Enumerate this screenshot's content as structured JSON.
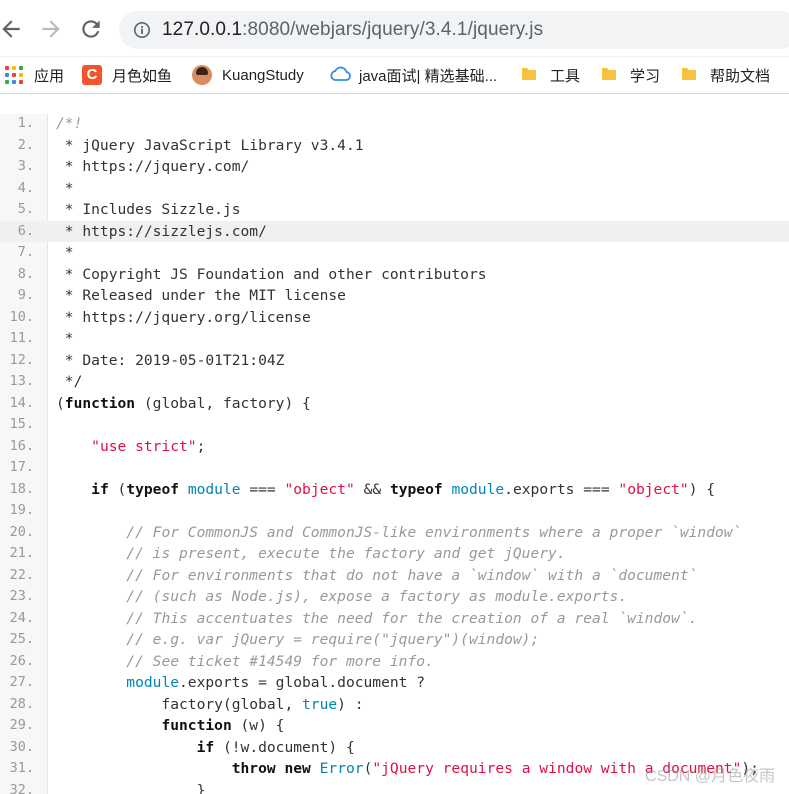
{
  "browser": {
    "url_host": "127.0.0.1",
    "url_rest": ":8080/webjars/jquery/3.4.1/jquery.js"
  },
  "bookmarks": [
    {
      "label": "应用",
      "icon": "apps-grid-icon"
    },
    {
      "label": "月色如鱼",
      "icon": "csdn-c-icon"
    },
    {
      "label": "KuangStudy",
      "icon": "avatar-icon"
    },
    {
      "label": "java面试| 精选基础...",
      "icon": "cloud-icon"
    },
    {
      "label": "工具",
      "icon": "folder-icon"
    },
    {
      "label": "学习",
      "icon": "folder-icon"
    },
    {
      "label": "帮助文档",
      "icon": "folder-icon"
    }
  ],
  "colors": {
    "keyword": "#111111",
    "string": "#dd1144",
    "comment": "#999999",
    "identifier": "#0086b3"
  },
  "code_lines": [
    {
      "n": "1.",
      "parts": [
        [
          "cm",
          "/*!"
        ]
      ]
    },
    {
      "n": "2.",
      "parts": [
        [
          "",
          " * jQuery JavaScript Library v3.4.1"
        ]
      ]
    },
    {
      "n": "3.",
      "parts": [
        [
          "",
          " * https://jquery.com/"
        ]
      ]
    },
    {
      "n": "4.",
      "parts": [
        [
          "",
          " *"
        ]
      ]
    },
    {
      "n": "5.",
      "parts": [
        [
          "",
          " * Includes Sizzle.js"
        ]
      ]
    },
    {
      "n": "6.",
      "parts": [
        [
          "",
          " * https://sizzlejs.com/"
        ]
      ]
    },
    {
      "n": "7.",
      "parts": [
        [
          "",
          " *"
        ]
      ]
    },
    {
      "n": "8.",
      "parts": [
        [
          "",
          " * Copyright JS Foundation and other contributors"
        ]
      ]
    },
    {
      "n": "9.",
      "parts": [
        [
          "",
          " * Released under the MIT license"
        ]
      ]
    },
    {
      "n": "10.",
      "parts": [
        [
          "",
          " * https://jquery.org/license"
        ]
      ]
    },
    {
      "n": "11.",
      "parts": [
        [
          "",
          " *"
        ]
      ]
    },
    {
      "n": "12.",
      "parts": [
        [
          "",
          " * Date: 2019-05-01T21:04Z"
        ]
      ]
    },
    {
      "n": "13.",
      "parts": [
        [
          "",
          " */"
        ]
      ]
    },
    {
      "n": "14.",
      "parts": [
        [
          "",
          "("
        ],
        [
          "kw",
          "function"
        ],
        [
          "",
          " (global, factory) {"
        ]
      ]
    },
    {
      "n": "15.",
      "parts": [
        [
          "",
          ""
        ]
      ]
    },
    {
      "n": "16.",
      "parts": [
        [
          "",
          "    "
        ],
        [
          "st",
          "\"use strict\""
        ],
        [
          "",
          ";"
        ]
      ]
    },
    {
      "n": "17.",
      "parts": [
        [
          "",
          ""
        ]
      ]
    },
    {
      "n": "18.",
      "parts": [
        [
          "",
          "    "
        ],
        [
          "kw",
          "if"
        ],
        [
          "",
          " ("
        ],
        [
          "kw",
          "typeof"
        ],
        [
          "",
          " "
        ],
        [
          "id",
          "module"
        ],
        [
          "",
          " === "
        ],
        [
          "st",
          "\"object\""
        ],
        [
          "",
          " && "
        ],
        [
          "kw",
          "typeof"
        ],
        [
          "",
          " "
        ],
        [
          "id",
          "module"
        ],
        [
          "",
          ".exports === "
        ],
        [
          "st",
          "\"object\""
        ],
        [
          "",
          ") {"
        ]
      ]
    },
    {
      "n": "19.",
      "parts": [
        [
          "",
          ""
        ]
      ]
    },
    {
      "n": "20.",
      "parts": [
        [
          "",
          "        "
        ],
        [
          "cm",
          "// For CommonJS and CommonJS-like environments where a proper `window`"
        ]
      ]
    },
    {
      "n": "21.",
      "parts": [
        [
          "",
          "        "
        ],
        [
          "cm",
          "// is present, execute the factory and get jQuery."
        ]
      ]
    },
    {
      "n": "22.",
      "parts": [
        [
          "",
          "        "
        ],
        [
          "cm",
          "// For environments that do not have a `window` with a `document`"
        ]
      ]
    },
    {
      "n": "23.",
      "parts": [
        [
          "",
          "        "
        ],
        [
          "cm",
          "// (such as Node.js), expose a factory as module.exports."
        ]
      ]
    },
    {
      "n": "24.",
      "parts": [
        [
          "",
          "        "
        ],
        [
          "cm",
          "// This accentuates the need for the creation of a real `window`."
        ]
      ]
    },
    {
      "n": "25.",
      "parts": [
        [
          "",
          "        "
        ],
        [
          "cm",
          "// e.g. var jQuery = require(\"jquery\")(window);"
        ]
      ]
    },
    {
      "n": "26.",
      "parts": [
        [
          "",
          "        "
        ],
        [
          "cm",
          "// See ticket #14549 for more info."
        ]
      ]
    },
    {
      "n": "27.",
      "parts": [
        [
          "",
          "        "
        ],
        [
          "id",
          "module"
        ],
        [
          "",
          ".exports = global.document ?"
        ]
      ]
    },
    {
      "n": "28.",
      "parts": [
        [
          "",
          "            factory(global, "
        ],
        [
          "id",
          "true"
        ],
        [
          "",
          ") :"
        ]
      ]
    },
    {
      "n": "29.",
      "parts": [
        [
          "",
          "            "
        ],
        [
          "kw",
          "function"
        ],
        [
          "",
          " (w) {"
        ]
      ]
    },
    {
      "n": "30.",
      "parts": [
        [
          "",
          "                "
        ],
        [
          "kw",
          "if"
        ],
        [
          "",
          " (!w.document) {"
        ]
      ]
    },
    {
      "n": "31.",
      "parts": [
        [
          "",
          "                    "
        ],
        [
          "kw",
          "throw"
        ],
        [
          "",
          " "
        ],
        [
          "kw",
          "new"
        ],
        [
          "",
          " "
        ],
        [
          "id",
          "Error"
        ],
        [
          "",
          "("
        ],
        [
          "st",
          "\"jQuery requires a window with a document\""
        ],
        [
          "",
          ");"
        ]
      ]
    },
    {
      "n": "32.",
      "parts": [
        [
          "",
          "                }"
        ]
      ]
    }
  ],
  "highlight_line": "6.",
  "watermark": "CSDN @月色夜雨"
}
